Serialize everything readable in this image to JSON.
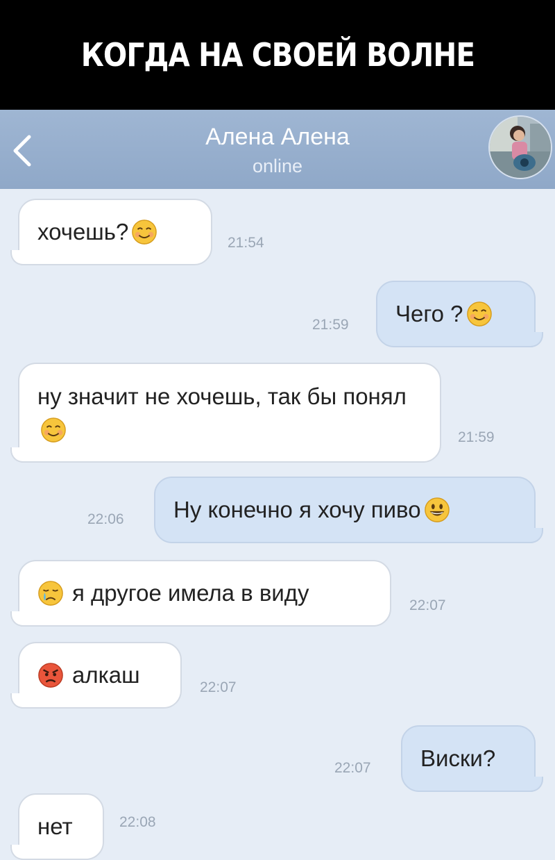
{
  "banner": {
    "text": "КОГДА НА СВОЕЙ ВОЛНЕ"
  },
  "header": {
    "title": "Алена Алена",
    "status": "online",
    "back_icon": "chevron-left-icon",
    "avatar_icon": "avatar"
  },
  "colors": {
    "header_bg": "#94abcb",
    "chat_bg": "#e6edf6",
    "incoming_bubble": "#ffffff",
    "outgoing_bubble": "#d4e3f5"
  },
  "messages": [
    {
      "dir": "in",
      "text": "хочешь?",
      "emoji": "smiling-blush-emoji",
      "time": "21:54"
    },
    {
      "dir": "out",
      "text": "Чего ?",
      "emoji": "smiling-blush-emoji",
      "time": "21:59"
    },
    {
      "dir": "in",
      "text": "ну значит не хочешь, так бы понял",
      "emoji": "smiling-blush-emoji",
      "time": "21:59"
    },
    {
      "dir": "out",
      "text": "Ну конечно я хочу пиво",
      "emoji": "grinning-emoji",
      "time": "22:06"
    },
    {
      "dir": "in",
      "text": "я другое имела в виду",
      "emoji": "crying-emoji",
      "time": "22:07"
    },
    {
      "dir": "in",
      "text": "алкаш",
      "emoji": "angry-face-emoji",
      "time": "22:07"
    },
    {
      "dir": "out",
      "text": "Виски?",
      "time": "22:07"
    },
    {
      "dir": "in",
      "text": "нет",
      "time": "22:08"
    }
  ]
}
